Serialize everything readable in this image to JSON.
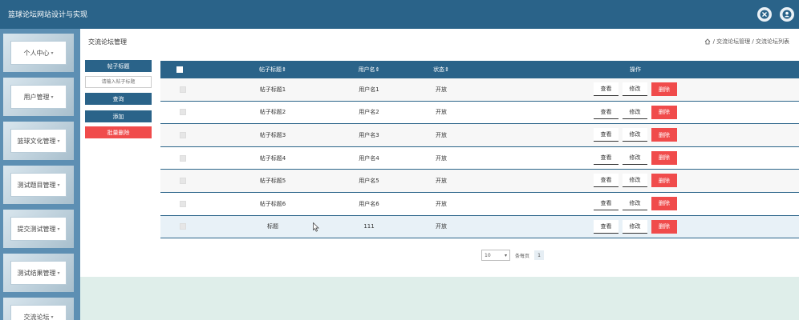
{
  "header": {
    "title": "篮球论坛网站设计与实现",
    "icons": [
      "close-circle-icon",
      "user-icon"
    ]
  },
  "sidebar": {
    "items": [
      {
        "label": "个人中心"
      },
      {
        "label": "用户管理"
      },
      {
        "label": "篮球文化管理"
      },
      {
        "label": "测试题目管理"
      },
      {
        "label": "提交测试管理"
      },
      {
        "label": "测试结果管理"
      },
      {
        "label": "交流论坛"
      }
    ]
  },
  "main": {
    "title": "交流论坛管理",
    "breadcrumb": {
      "home_icon": "home-icon",
      "path": "/ 交流论坛管理 / 交流论坛列表"
    }
  },
  "controls": {
    "field_label": "帖子标题",
    "input_placeholder": "请输入帖子标题",
    "search_label": "查询",
    "add_label": "添加",
    "batch_delete_label": "批量删除"
  },
  "table": {
    "columns": [
      "帖子标题",
      "用户名",
      "状态",
      "操作"
    ],
    "sort_mark": "⇕",
    "rows": [
      {
        "title": "帖子标题1",
        "user": "用户名1",
        "status": "开放"
      },
      {
        "title": "帖子标题2",
        "user": "用户名2",
        "status": "开放"
      },
      {
        "title": "帖子标题3",
        "user": "用户名3",
        "status": "开放"
      },
      {
        "title": "帖子标题4",
        "user": "用户名4",
        "status": "开放"
      },
      {
        "title": "帖子标题5",
        "user": "用户名5",
        "status": "开放"
      },
      {
        "title": "帖子标题6",
        "user": "用户名6",
        "status": "开放"
      },
      {
        "title": "标题",
        "user": "111",
        "status": "开放"
      }
    ],
    "actions": {
      "view": "查看",
      "edit": "修改",
      "delete": "删除"
    }
  },
  "pagination": {
    "page_size": "10",
    "page_size_label": "条每页",
    "current_page": "1"
  },
  "colors": {
    "primary": "#2a6389",
    "danger": "#f04b4b",
    "sidebar": "#5d8fb3"
  }
}
